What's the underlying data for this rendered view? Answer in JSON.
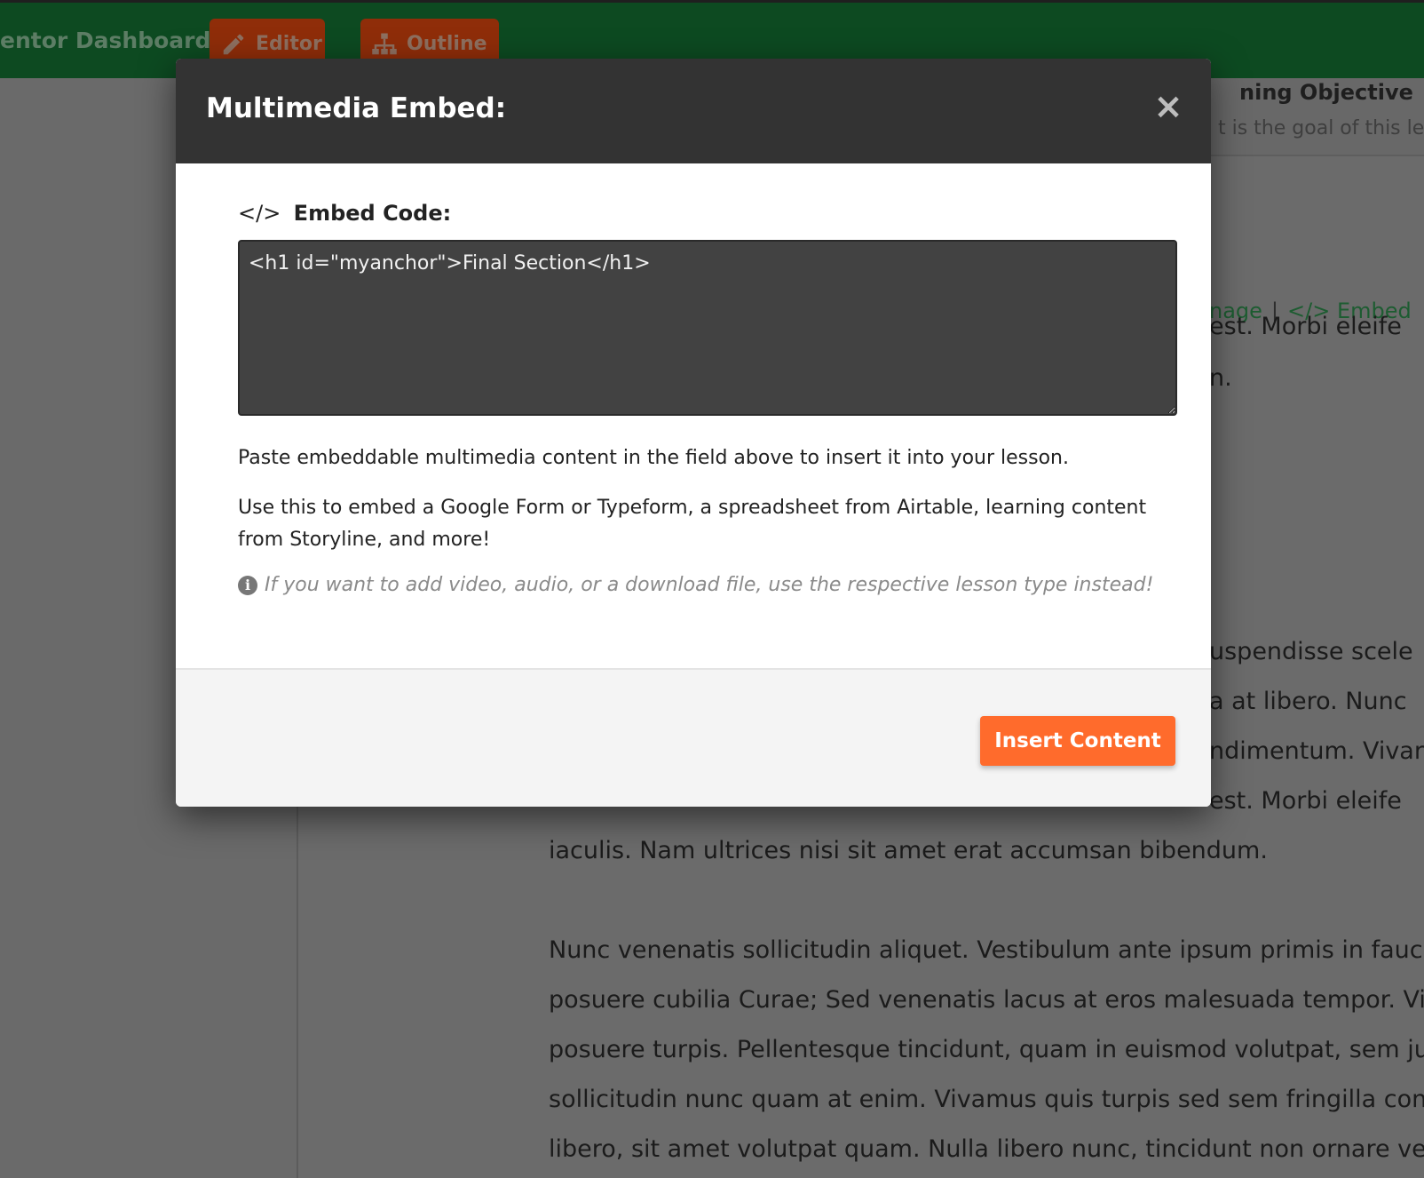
{
  "nav": {
    "title": "entor Dashboard",
    "editor_label": "Editor",
    "outline_label": "Outline"
  },
  "right_panel": {
    "objective_title": "ning Objective",
    "objective_placeholder": "t is the goal of this le",
    "toolbar_image": "nage",
    "toolbar_sep": "|",
    "toolbar_embed": "</> Embed"
  },
  "background_text": {
    "peek_lines": [
      "est. Morbi eleife",
      "n.",
      "uspendisse scele",
      "a at libero. Nunc",
      "ndimentum. Vivar",
      "est. Morbi eleife"
    ],
    "para1_last": "iaculis. Nam ultrices nisi sit amet erat accumsan bibendum.",
    "para2": [
      "Nunc venenatis sollicitudin aliquet. Vestibulum ante ipsum primis in faucib",
      "posuere cubilia Curae; Sed venenatis lacus at eros malesuada tempor. Viva",
      "posuere turpis. Pellentesque tincidunt, quam in euismod volutpat, sem jus",
      "sollicitudin nunc quam at enim. Vivamus quis turpis sed sem fringilla cond",
      "libero, sit amet volutpat quam. Nulla libero nunc, tincidunt non ornare vel,"
    ]
  },
  "modal": {
    "title": "Multimedia Embed:",
    "close": "×",
    "field_icon": "</>",
    "field_label": "Embed Code:",
    "embed_value": "<h1 id=\"myanchor\">Final Section</h1>",
    "help1": "Paste embeddable multimedia content in the field above to insert it into your lesson.",
    "help2": "Use this to embed a Google Form or Typeform, a spreadsheet from Airtable, learning content from Storyline, and more!",
    "hint_icon": "i",
    "hint": "If you want to add video, audio, or a download file, use the respective lesson type instead!",
    "insert_label": "Insert Content"
  },
  "colors": {
    "header_green": "#0d4a21",
    "nav_button": "#8f2d09",
    "modal_header": "#333333",
    "accent_orange": "#ff6b2c",
    "textarea_bg": "#424242"
  }
}
